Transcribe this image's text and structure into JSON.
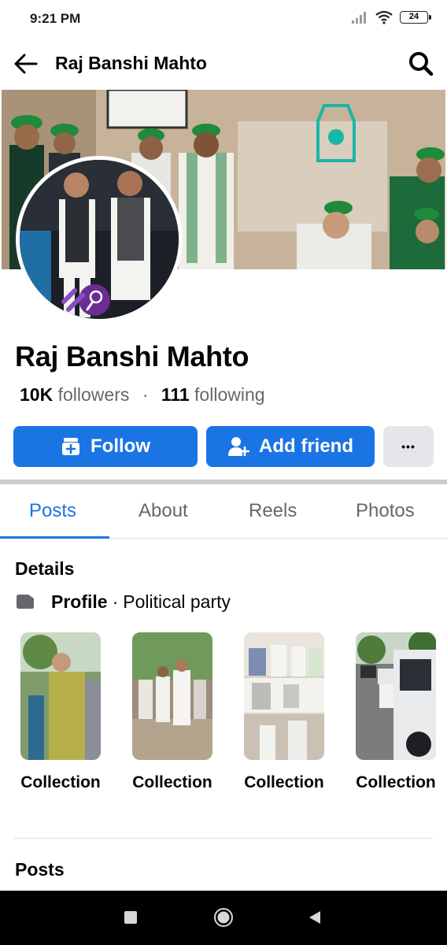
{
  "status_bar": {
    "time": "9:21 PM",
    "battery": "24"
  },
  "header": {
    "title": "Raj Banshi Mahto"
  },
  "profile": {
    "name": "Raj Banshi Mahto",
    "followers_count": "10K",
    "followers_label": "followers",
    "separator": "·",
    "following_count": "111",
    "following_label": "following"
  },
  "actions": {
    "follow_label": "Follow",
    "add_friend_label": "Add friend",
    "more_label": "•••"
  },
  "tabs": [
    {
      "label": "Posts",
      "active": true
    },
    {
      "label": "About",
      "active": false
    },
    {
      "label": "Reels",
      "active": false
    },
    {
      "label": "Photos",
      "active": false
    }
  ],
  "details": {
    "heading": "Details",
    "category_label": "Profile",
    "separator": "·",
    "category_value": "Political party"
  },
  "collections": [
    {
      "label": "Collection"
    },
    {
      "label": "Collection"
    },
    {
      "label": "Collection"
    },
    {
      "label": "Collection"
    }
  ],
  "posts": {
    "heading": "Posts"
  },
  "icons": [
    "back-arrow-icon",
    "search-icon",
    "follow-icon",
    "add-friend-icon",
    "more-icon",
    "page-icon",
    "recents-icon",
    "home-icon",
    "back-icon"
  ],
  "colors": {
    "accent": "#1b74e4",
    "secondary_button": "#e4e6eb",
    "muted_text": "#65676b"
  }
}
